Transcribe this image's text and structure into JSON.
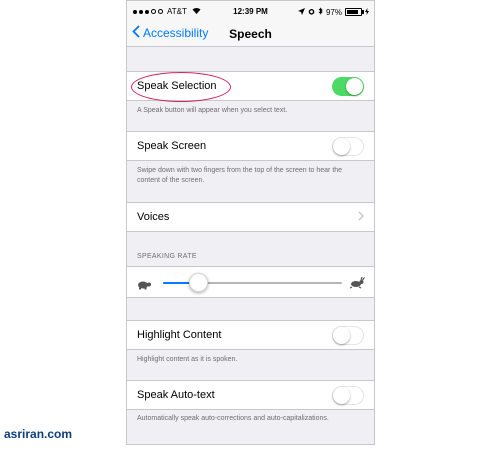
{
  "status_bar": {
    "carrier": "AT&T",
    "time": "12:39 PM",
    "battery_text": "97%",
    "battery_level": 0.97
  },
  "nav": {
    "back_label": "Accessibility",
    "title": "Speech"
  },
  "speak_selection": {
    "label": "Speak Selection",
    "on": true,
    "footer": "A Speak button will appear when you select text."
  },
  "speak_screen": {
    "label": "Speak Screen",
    "on": false,
    "footer": "Swipe down with two fingers from the top of the screen to hear the content of the screen."
  },
  "voices": {
    "label": "Voices"
  },
  "speaking_rate": {
    "header": "SPEAKING RATE",
    "value": 0.2,
    "slow_icon": "turtle-icon",
    "fast_icon": "hare-icon"
  },
  "highlight_content": {
    "label": "Highlight Content",
    "on": false,
    "footer": "Highlight content as it is spoken."
  },
  "speak_auto_text": {
    "label": "Speak Auto-text",
    "on": false,
    "footer": "Automatically speak auto-corrections and auto-capitalizations."
  },
  "colors": {
    "accent": "#007aff",
    "toggle_on": "#4cd964",
    "annotation": "#d0245b",
    "watermark": "#0d3d7a"
  },
  "watermark": "asriran.com"
}
